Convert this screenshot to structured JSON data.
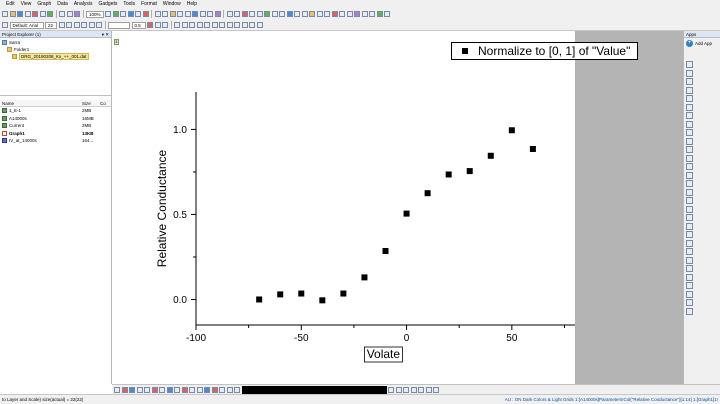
{
  "menu": [
    "Edit",
    "View",
    "Graph",
    "Data",
    "Analysis",
    "Gadgets",
    "Tools",
    "Format",
    "Window",
    "Help"
  ],
  "toolbar": {
    "zoom": "100%",
    "font": "Default: Arial",
    "font_size": "22",
    "line_width": "0.5"
  },
  "project_explorer": {
    "title": "Project Explorer (1)",
    "tree": [
      {
        "label": "Sarra",
        "icon": "project-icon",
        "indent": 0
      },
      {
        "label": "Folder1",
        "icon": "folder-icon",
        "indent": 1
      },
      {
        "label": "DRG_20190208_Kx_++_001.dat",
        "icon": "folder-icon",
        "indent": 2,
        "selected": true
      }
    ],
    "columns": [
      "Name",
      "Size",
      "Co"
    ],
    "files": [
      {
        "name": "1_E-1",
        "size": "2MB",
        "icon": "book-icon",
        "bold": false
      },
      {
        "name": "A14000s",
        "size": "16MB",
        "icon": "book-icon",
        "bold": false
      },
      {
        "name": "Current",
        "size": "2MB",
        "icon": "book-icon",
        "bold": false
      },
      {
        "name": "Graph1",
        "size": "13KB",
        "icon": "graph-icon",
        "bold": true
      },
      {
        "name": "IV_at_14000s",
        "size": "164...",
        "icon": "matrix-icon",
        "bold": false
      }
    ]
  },
  "layer_tab": "1",
  "apps": {
    "title": "Apps",
    "add_label": "Add App"
  },
  "legend": {
    "label": "Normalize to [0, 1] of \"Value\""
  },
  "chart_data": {
    "type": "scatter",
    "xlabel": "Volate",
    "ylabel": "Relative Conductance",
    "xlim": [
      -100,
      80
    ],
    "ylim": [
      -0.15,
      1.22
    ],
    "xticks": [
      -100,
      -50,
      0,
      50
    ],
    "yticks": [
      0.0,
      0.5,
      1.0
    ],
    "xtick_labels": [
      "-100",
      "-50",
      "0",
      "50"
    ],
    "ytick_labels": [
      "0.0",
      "0.5",
      "1.0"
    ],
    "grid": false,
    "legend_position": "top-right",
    "marker_color": "#000000",
    "series": [
      {
        "name": "Normalize to [0, 1] of \"Value\"",
        "x": [
          -70,
          -60,
          -50,
          -40,
          -30,
          -20,
          -10,
          0,
          10,
          20,
          30,
          40,
          50,
          60
        ],
        "y": [
          0.0,
          0.03,
          0.035,
          -0.005,
          0.035,
          0.13,
          0.285,
          0.505,
          0.625,
          0.735,
          0.755,
          0.845,
          0.995,
          0.885
        ]
      }
    ]
  },
  "status": {
    "left": "to Layer and Scale) size(actual) = 22(22)",
    "right": "AU : ON  Dark Colors & Light Grids  1:[A14000s]Parameters!Col(\"Relative Conductance\")[1:14]  1:[Graph1]1!"
  }
}
